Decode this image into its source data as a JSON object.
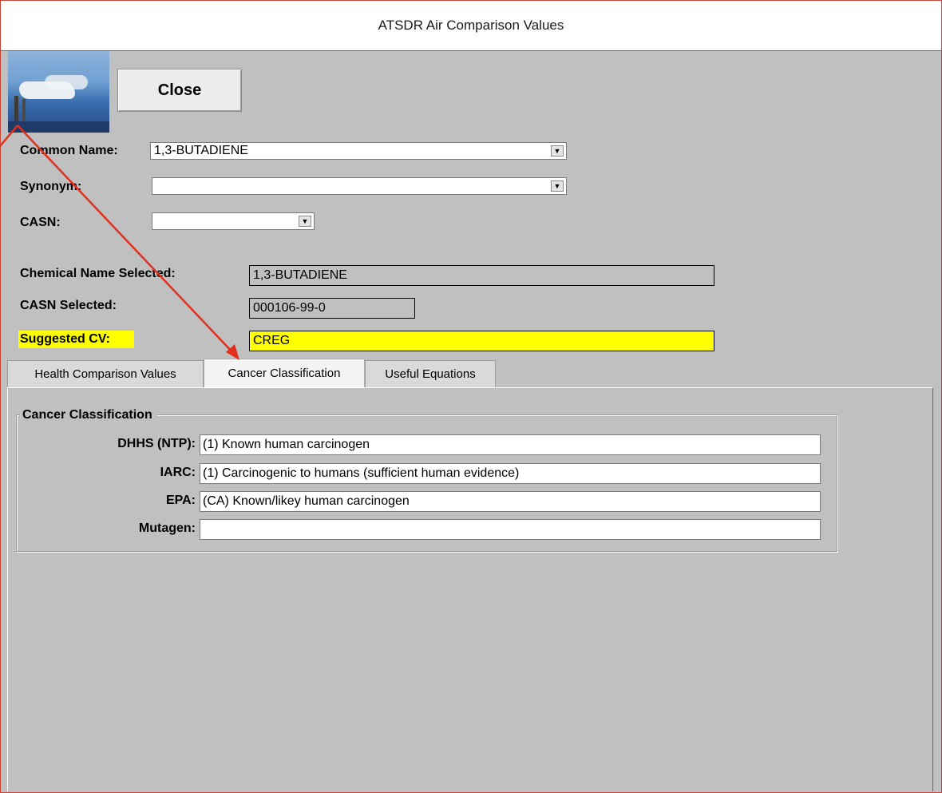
{
  "window": {
    "title": "ATSDR Air Comparison Values"
  },
  "toolbar": {
    "close_label": "Close"
  },
  "selectors": {
    "common_name": {
      "label": "Common Name:",
      "value": "1,3-BUTADIENE"
    },
    "synonym": {
      "label": "Synonym:",
      "value": ""
    },
    "casn": {
      "label": "CASN:",
      "value": ""
    }
  },
  "selected": {
    "chemical_name": {
      "label": "Chemical Name Selected:",
      "value": "1,3-BUTADIENE"
    },
    "casn": {
      "label": "CASN Selected:",
      "value": "000106-99-0"
    },
    "suggested_cv": {
      "label": "Suggested CV:",
      "value": "CREG",
      "highlight_color": "#ffff00"
    }
  },
  "tabs": [
    {
      "label": "Health Comparison Values",
      "active": false
    },
    {
      "label": "Cancer Classification",
      "active": true
    },
    {
      "label": "Useful Equations",
      "active": false
    }
  ],
  "cancer_classification": {
    "group_title": "Cancer Classification",
    "fields": [
      {
        "label": "DHHS (NTP):",
        "value": "(1) Known human carcinogen"
      },
      {
        "label": "IARC:",
        "value": "(1) Carcinogenic to humans (sufficient human evidence)"
      },
      {
        "label": "EPA:",
        "value": "(CA) Known/likey human carcinogen"
      },
      {
        "label": "Mutagen:",
        "value": ""
      }
    ]
  },
  "annotation": {
    "color": "#e0301e"
  }
}
